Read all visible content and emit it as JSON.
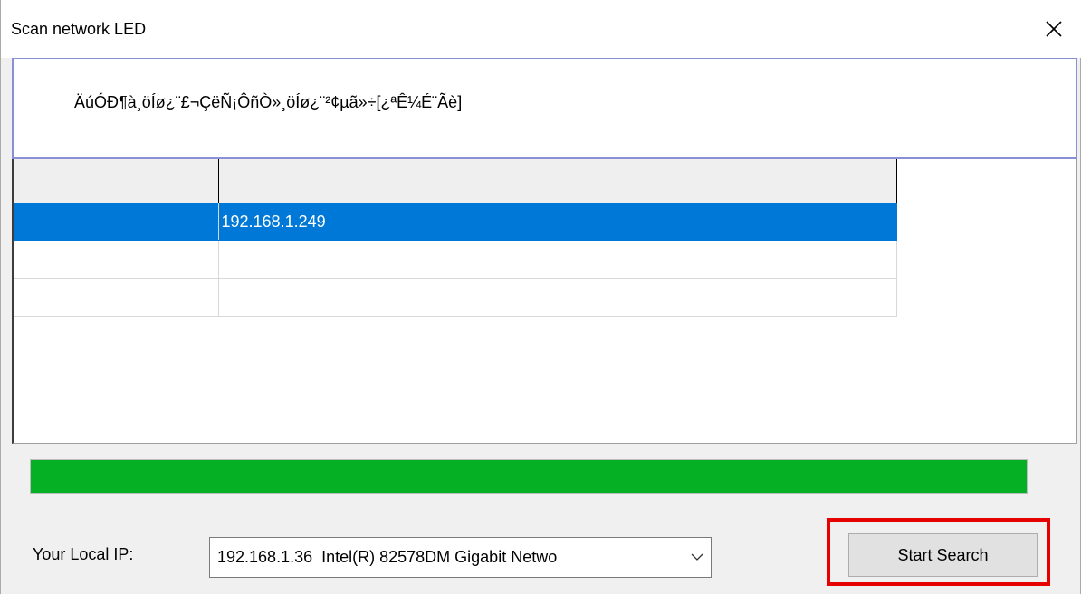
{
  "window": {
    "title": "Scan network LED"
  },
  "message": {
    "text": "ÄúÓÐ¶à¸öÍø¿¨£¬ÇëÑ¡ÔñÒ»¸öÍø¿¨²¢µã»÷[¿ªÊ¼É¨Ãè]"
  },
  "device_table": {
    "columns": [
      "",
      "",
      ""
    ],
    "rows": [
      {
        "cells": [
          "",
          "192.168.1.249",
          ""
        ],
        "selected": true
      },
      {
        "cells": [
          "",
          "",
          ""
        ],
        "selected": false
      },
      {
        "cells": [
          "",
          "",
          ""
        ],
        "selected": false
      }
    ]
  },
  "progress": {
    "value_percent": 100,
    "color": "#06b025"
  },
  "local_ip": {
    "label": "Your Local IP:",
    "selected_value": "192.168.1.36  Intel(R) 82578DM Gigabit Netwo"
  },
  "actions": {
    "start_search_label": "Start Search"
  },
  "colors": {
    "selection": "#0078d7",
    "highlight": "#e60000",
    "message_border": "#8a90d8"
  }
}
